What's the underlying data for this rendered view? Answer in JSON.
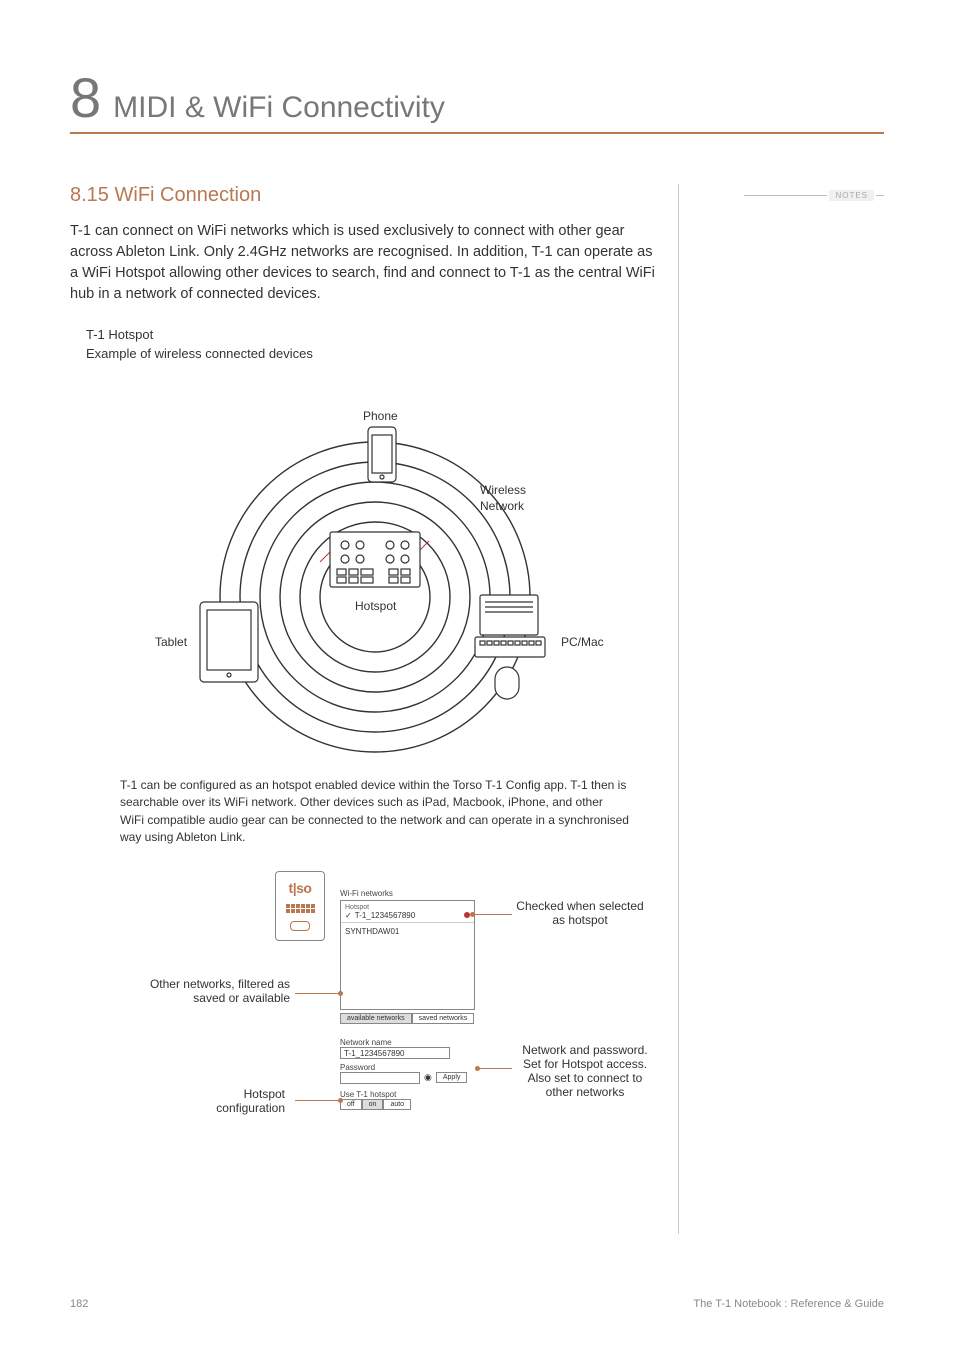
{
  "chapter": {
    "num": "8",
    "title": "MIDI & WiFi Connectivity"
  },
  "section": {
    "num": "8.15",
    "title": "WiFi Connection"
  },
  "notes_label": "NOTES",
  "intro": "T-1 can connect on WiFi networks which is used exclusively to connect with other gear across Ableton Link. Only 2.4GHz networks are recognised. In addition, T-1 can operate as a WiFi Hotspot allowing other devices to search, find and connect to T-1 as the central WiFi hub in a network of connected devices.",
  "example": {
    "line1": "T-1 Hotspot",
    "line2": "Example of wireless connected devices"
  },
  "diagram": {
    "phone": "Phone",
    "wireless": "Wireless",
    "network": "Network",
    "tablet": "Tablet",
    "hotspot": "Hotspot",
    "pc": "PC/Mac"
  },
  "config_caption": "T-1 can be configured as an hotspot enabled device within the Torso T-1 Config app. T-1 then is searchable over its WiFi network. Other devices such as iPad, Macbook, iPhone, and other WiFi compatible audio gear can be connected to the network and can operate in a synchronised way using Ableton Link.",
  "config": {
    "logo": "t|so",
    "wifi_networks": "Wi-Fi networks",
    "hotspot_label": "Hotspot",
    "ssid1": "T-1_1234567890",
    "ssid2": "SYNTHDAW01",
    "available": "available networks",
    "saved": "saved networks",
    "network_name": "Network name",
    "network_value": "T-1_1234567890",
    "password": "Password",
    "apply": "Apply",
    "use_hotspot": "Use T-1 hotspot",
    "off": "off",
    "on": "on",
    "auto": "auto"
  },
  "callouts": {
    "checked": "Checked when selected as hotspot",
    "other_networks": "Other networks, filtered as saved or available",
    "hotspot_config": "Hotspot configuration",
    "net_pwd": "Network and password. Set for Hotspot access. Also set to connect to other networks"
  },
  "footer": {
    "page": "182",
    "book": "The T-1 Notebook : Reference & Guide"
  }
}
